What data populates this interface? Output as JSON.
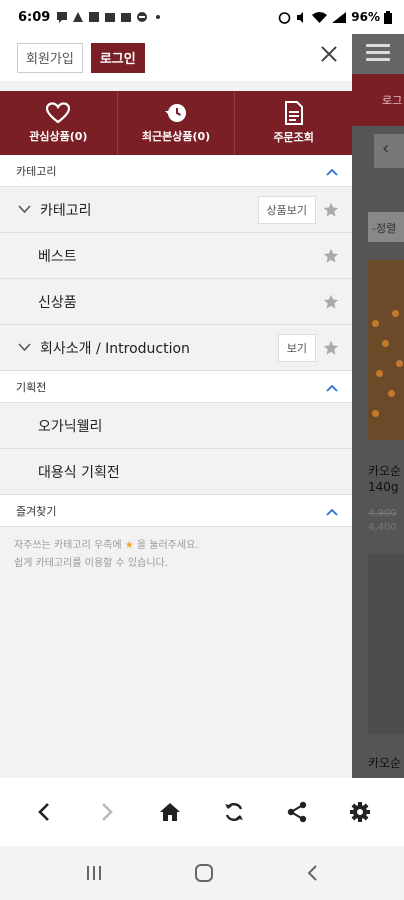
{
  "status_bar": {
    "time": "6:09",
    "battery": "96%",
    "left_icons": [
      "chat-icon",
      "alert-icon",
      "image-icon",
      "mail-icon",
      "mail-icon",
      "dash-icon",
      "dot-icon"
    ]
  },
  "drawer": {
    "join_label": "회원가입",
    "login_label": "로그인",
    "quick_menu": [
      {
        "label": "관심상품(0)",
        "icon": "heart-icon"
      },
      {
        "label": "최근본상품(0)",
        "icon": "history-icon"
      },
      {
        "label": "주문조회",
        "icon": "document-icon"
      }
    ],
    "category_section": {
      "title": "카테고리",
      "items": [
        {
          "label": "카테고리",
          "action": "상품보기"
        },
        {
          "label": "베스트"
        },
        {
          "label": "신상품"
        },
        {
          "label": "회사소개 / Introduction",
          "action": "보기"
        }
      ]
    },
    "promo_section": {
      "title": "기획전",
      "items": [
        {
          "label": "오가닉웰리"
        },
        {
          "label": "대용식 기획전"
        }
      ]
    },
    "favorites_section": {
      "title": "즐겨찾기",
      "note_prefix": "자주쓰는 카테고리 우측에",
      "note_suffix": "을 눌러주세요.",
      "note_line2": "쉽게 카테고리를 이용할 수 있습니다."
    }
  },
  "background_page": {
    "header_text": "로그",
    "sort_text": "-정렬",
    "product1_name": "카오순",
    "product1_weight": "140g",
    "product1_price_old": "4,900",
    "product1_price": "4,400",
    "product2_name": "카오순"
  },
  "colors": {
    "brand": "#7b1f26",
    "accent_blue": "#2a6fd6",
    "star_gray": "#aaaaaa",
    "star_gold": "#f5a623"
  }
}
